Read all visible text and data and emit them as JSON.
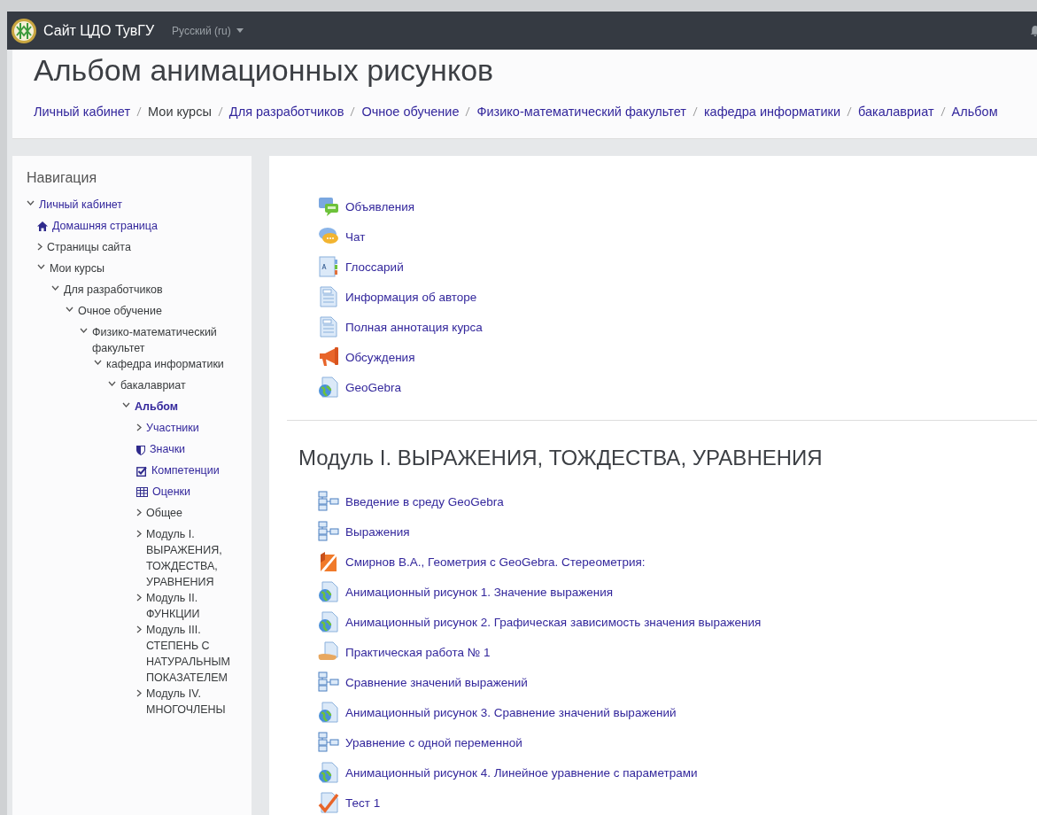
{
  "navbar": {
    "site_name": "Сайт ЦДО ТувГУ",
    "language": "Русский (ru)"
  },
  "header": {
    "title": "Альбом анимационных рисунков",
    "breadcrumbs": [
      {
        "label": "Личный кабинет",
        "link": true
      },
      {
        "label": "Мои курсы",
        "link": false
      },
      {
        "label": "Для разработчиков",
        "link": true
      },
      {
        "label": "Очное обучение",
        "link": true
      },
      {
        "label": "Физико-математический факультет",
        "link": true
      },
      {
        "label": "кафедра информатики",
        "link": true
      },
      {
        "label": "бакалавриат",
        "link": true
      },
      {
        "label": "Альбом",
        "link": true
      }
    ]
  },
  "navigation": {
    "title": "Навигация",
    "items": [
      {
        "kind": "branch",
        "label": "Личный кабинет",
        "link": true,
        "expanded": true,
        "current": false,
        "children": [
          {
            "kind": "home",
            "label": "Домашняя страница",
            "link": true,
            "current": false
          },
          {
            "kind": "branch",
            "label": "Страницы сайта",
            "link": false,
            "expanded": false,
            "current": false
          },
          {
            "kind": "branch",
            "label": "Мои курсы",
            "link": false,
            "expanded": true,
            "current": false,
            "children": [
              {
                "kind": "branch",
                "label": "Для разработчиков",
                "link": false,
                "expanded": true,
                "current": false,
                "children": [
                  {
                    "kind": "branch",
                    "label": "Очное обучение",
                    "link": false,
                    "expanded": true,
                    "current": false,
                    "children": [
                      {
                        "kind": "branch",
                        "label": "Физико-математический факультет",
                        "link": false,
                        "expanded": true,
                        "current": false,
                        "children": [
                          {
                            "kind": "branch",
                            "label": "кафедра информатики",
                            "link": false,
                            "expanded": true,
                            "current": false,
                            "children": [
                              {
                                "kind": "branch",
                                "label": "бакалавриат",
                                "link": false,
                                "expanded": true,
                                "current": false,
                                "children": [
                                  {
                                    "kind": "branch",
                                    "label": "Альбом",
                                    "link": true,
                                    "expanded": true,
                                    "current": true,
                                    "children": [
                                      {
                                        "kind": "branch",
                                        "label": "Участники",
                                        "link": true,
                                        "expanded": false,
                                        "current": false
                                      },
                                      {
                                        "kind": "badges",
                                        "label": "Значки",
                                        "link": true,
                                        "current": false
                                      },
                                      {
                                        "kind": "competencies",
                                        "label": "Компетенции",
                                        "link": true,
                                        "current": false
                                      },
                                      {
                                        "kind": "grades",
                                        "label": "Оценки",
                                        "link": true,
                                        "current": false
                                      },
                                      {
                                        "kind": "branch",
                                        "label": "Общее",
                                        "link": false,
                                        "expanded": false,
                                        "current": false
                                      },
                                      {
                                        "kind": "branch",
                                        "label": "Модуль I. ВЫРАЖЕНИЯ, ТОЖДЕСТВА, УРАВНЕНИЯ",
                                        "link": false,
                                        "expanded": false,
                                        "current": false
                                      },
                                      {
                                        "kind": "branch",
                                        "label": "Модуль II. ФУНКЦИИ",
                                        "link": false,
                                        "expanded": false,
                                        "current": false
                                      },
                                      {
                                        "kind": "branch",
                                        "label": "Модуль III. СТЕПЕНЬ С НАТУРАЛЬНЫМ ПОКАЗАТЕЛЕМ",
                                        "link": false,
                                        "expanded": false,
                                        "current": false
                                      },
                                      {
                                        "kind": "branch",
                                        "label": "Модуль IV. МНОГОЧЛЕНЫ",
                                        "link": false,
                                        "expanded": false,
                                        "current": false
                                      }
                                    ]
                                  }
                                ]
                              }
                            ]
                          }
                        ]
                      }
                    ]
                  }
                ]
              }
            ]
          }
        ]
      }
    ]
  },
  "sections": [
    {
      "activities": [
        {
          "kind": "news",
          "label": "Объявления"
        },
        {
          "kind": "chat",
          "label": "Чат"
        },
        {
          "kind": "glossary",
          "label": "Глоссарий"
        },
        {
          "kind": "page",
          "label": "Информация об авторе"
        },
        {
          "kind": "page",
          "label": "Полная аннотация курса"
        },
        {
          "kind": "forum",
          "label": "Обсуждения"
        },
        {
          "kind": "globe",
          "label": "GeoGebra"
        }
      ]
    },
    {
      "title": "Модуль I. ВЫРАЖЕНИЯ, ТОЖДЕСТВА, УРАВНЕНИЯ",
      "activities": [
        {
          "kind": "lesson",
          "label": "Введение в среду GeoGebra"
        },
        {
          "kind": "lesson",
          "label": "Выражения"
        },
        {
          "kind": "file",
          "label": "Смирнов В.А., Геометрия с GeoGebra. Стереометрия:"
        },
        {
          "kind": "globe",
          "label": "Анимационный рисунок 1. Значение выражения"
        },
        {
          "kind": "globe",
          "label": "Анимационный рисунок 2. Графическая зависимость значения выражения"
        },
        {
          "kind": "assign",
          "label": "Практическая работа № 1"
        },
        {
          "kind": "lesson",
          "label": "Сравнение значений выражений"
        },
        {
          "kind": "globe",
          "label": "Анимационный рисунок 3. Сравнение значений выражений"
        },
        {
          "kind": "lesson",
          "label": "Уравнение с одной переменной"
        },
        {
          "kind": "globe",
          "label": "Анимационный рисунок 4. Линейное уравнение с параметрами"
        },
        {
          "kind": "quiz",
          "label": "Тест 1"
        }
      ]
    }
  ]
}
